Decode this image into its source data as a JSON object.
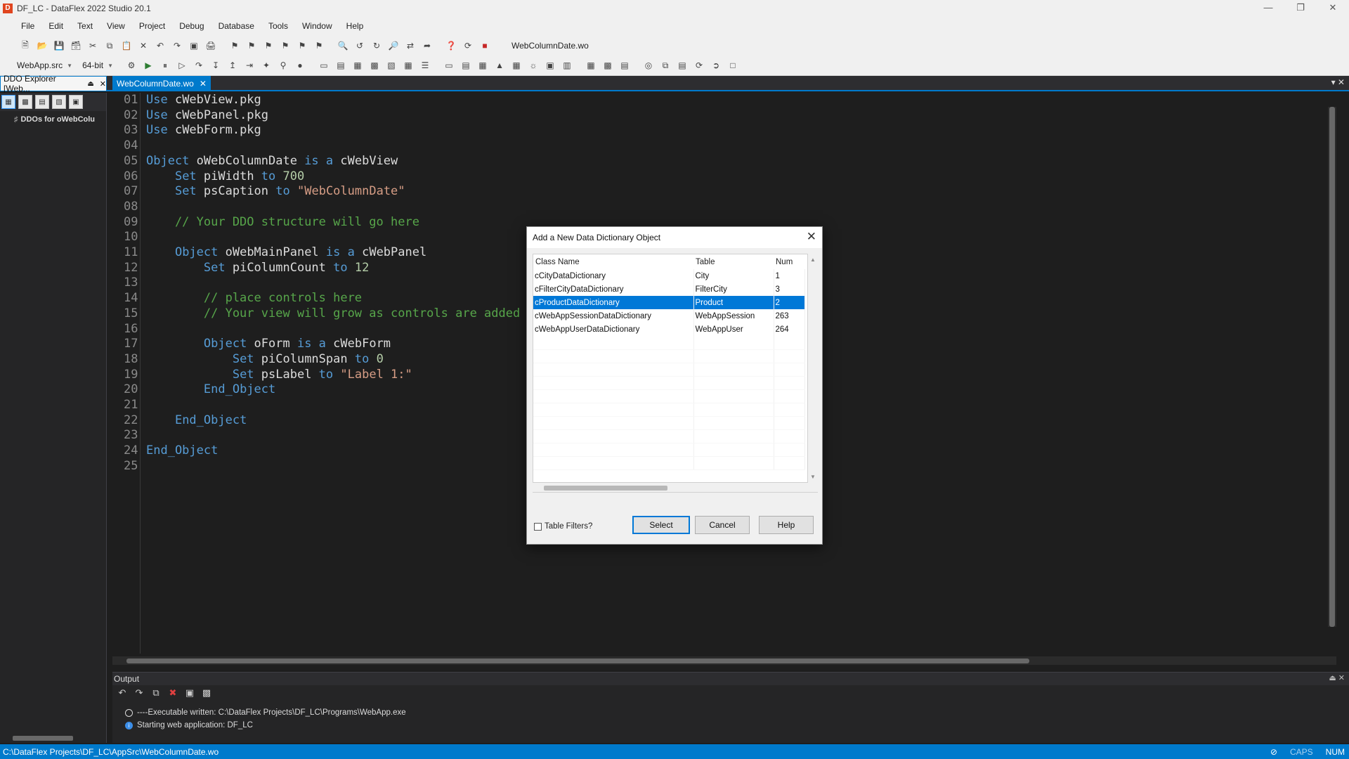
{
  "window": {
    "title": "DF_LC - DataFlex 2022 Studio 20.1",
    "app_icon": "dataflex-logo-icon",
    "controls": [
      "minimize",
      "restore",
      "close"
    ]
  },
  "menu": [
    "File",
    "Edit",
    "Text",
    "View",
    "Project",
    "Debug",
    "Database",
    "Tools",
    "Window",
    "Help"
  ],
  "toolbar": {
    "file_combo": "WebColumnDate.wo",
    "project_combo": "WebApp.src",
    "platform_combo": "64-bit"
  },
  "tabs": {
    "ddo_explorer": "DDO Explorer [Web...",
    "document": "WebColumnDate.wo"
  },
  "ddo_explorer": {
    "tree_root": "DDOs for oWebColu"
  },
  "editor": {
    "line_numbers": [
      "01",
      "02",
      "03",
      "04",
      "05",
      "06",
      "07",
      "08",
      "09",
      "10",
      "11",
      "12",
      "13",
      "14",
      "15",
      "16",
      "17",
      "18",
      "19",
      "20",
      "21",
      "22",
      "23",
      "24",
      "25"
    ],
    "lines": [
      [
        {
          "t": "Use",
          "c": "kw"
        },
        {
          "t": " cWebView.pkg",
          "c": ""
        }
      ],
      [
        {
          "t": "Use",
          "c": "kw"
        },
        {
          "t": " cWebPanel.pkg",
          "c": ""
        }
      ],
      [
        {
          "t": "Use",
          "c": "kw"
        },
        {
          "t": " cWebForm.pkg",
          "c": ""
        }
      ],
      [],
      [
        {
          "t": "Object",
          "c": "kw"
        },
        {
          "t": " oWebColumnDate ",
          "c": ""
        },
        {
          "t": "is a",
          "c": "kw"
        },
        {
          "t": " cWebView",
          "c": ""
        }
      ],
      [
        {
          "t": "    ",
          "c": ""
        },
        {
          "t": "Set",
          "c": "kw"
        },
        {
          "t": " piWidth ",
          "c": ""
        },
        {
          "t": "to",
          "c": "kw"
        },
        {
          "t": " ",
          "c": ""
        },
        {
          "t": "700",
          "c": "num"
        }
      ],
      [
        {
          "t": "    ",
          "c": ""
        },
        {
          "t": "Set",
          "c": "kw"
        },
        {
          "t": " psCaption ",
          "c": ""
        },
        {
          "t": "to",
          "c": "kw"
        },
        {
          "t": " ",
          "c": ""
        },
        {
          "t": "\"WebColumnDate\"",
          "c": "str"
        }
      ],
      [],
      [
        {
          "t": "    // Your DDO structure will go here",
          "c": "cmt"
        }
      ],
      [],
      [
        {
          "t": "    ",
          "c": ""
        },
        {
          "t": "Object",
          "c": "kw"
        },
        {
          "t": " oWebMainPanel ",
          "c": ""
        },
        {
          "t": "is a",
          "c": "kw"
        },
        {
          "t": " cWebPanel",
          "c": ""
        }
      ],
      [
        {
          "t": "        ",
          "c": ""
        },
        {
          "t": "Set",
          "c": "kw"
        },
        {
          "t": " piColumnCount ",
          "c": ""
        },
        {
          "t": "to",
          "c": "kw"
        },
        {
          "t": " ",
          "c": ""
        },
        {
          "t": "12",
          "c": "num"
        }
      ],
      [],
      [
        {
          "t": "        // place controls here",
          "c": "cmt"
        }
      ],
      [
        {
          "t": "        // Your view will grow as controls are added",
          "c": "cmt"
        }
      ],
      [],
      [
        {
          "t": "        ",
          "c": ""
        },
        {
          "t": "Object",
          "c": "kw"
        },
        {
          "t": " oForm ",
          "c": ""
        },
        {
          "t": "is a",
          "c": "kw"
        },
        {
          "t": " cWebForm",
          "c": ""
        }
      ],
      [
        {
          "t": "            ",
          "c": ""
        },
        {
          "t": "Set",
          "c": "kw"
        },
        {
          "t": " piColumnSpan ",
          "c": ""
        },
        {
          "t": "to",
          "c": "kw"
        },
        {
          "t": " ",
          "c": ""
        },
        {
          "t": "0",
          "c": "num"
        }
      ],
      [
        {
          "t": "            ",
          "c": ""
        },
        {
          "t": "Set",
          "c": "kw"
        },
        {
          "t": " psLabel ",
          "c": ""
        },
        {
          "t": "to",
          "c": "kw"
        },
        {
          "t": " ",
          "c": ""
        },
        {
          "t": "\"Label 1:\"",
          "c": "str"
        }
      ],
      [
        {
          "t": "        ",
          "c": ""
        },
        {
          "t": "End_Object",
          "c": "kw"
        }
      ],
      [],
      [
        {
          "t": "    ",
          "c": ""
        },
        {
          "t": "End_Object",
          "c": "kw"
        }
      ],
      [],
      [
        {
          "t": "End_Object",
          "c": "kw"
        }
      ],
      []
    ],
    "colors": {
      "keyword": "#569cd6",
      "string": "#d69d85",
      "number": "#b5cea8",
      "comment": "#57a64a"
    }
  },
  "dialog": {
    "title": "Add a New Data Dictionary Object",
    "columns": [
      "Class Name",
      "Table",
      "Num"
    ],
    "rows": [
      {
        "class_name": "cCityDataDictionary",
        "table": "City",
        "num": "1",
        "selected": false
      },
      {
        "class_name": "cFilterCityDataDictionary",
        "table": "FilterCity",
        "num": "3",
        "selected": false
      },
      {
        "class_name": "cProductDataDictionary",
        "table": "Product",
        "num": "2",
        "selected": true
      },
      {
        "class_name": "cWebAppSessionDataDictionary",
        "table": "WebAppSession",
        "num": "263",
        "selected": false
      },
      {
        "class_name": "cWebAppUserDataDictionary",
        "table": "WebAppUser",
        "num": "264",
        "selected": false
      }
    ],
    "table_filters_label": "Table Filters?",
    "table_filters_checked": false,
    "select_label": "Select",
    "cancel_label": "Cancel",
    "help_label": "Help"
  },
  "output": {
    "title": "Output",
    "lines": [
      {
        "icon": "circle-icon",
        "text": "----Executable written: C:\\DataFlex Projects\\DF_LC\\Programs\\WebApp.exe"
      },
      {
        "icon": "info-icon",
        "text": "Starting web application: DF_LC"
      }
    ]
  },
  "status": {
    "path": "C:\\DataFlex Projects\\DF_LC\\AppSrc\\WebColumnDate.wo",
    "caps": "CAPS",
    "num": "NUM"
  },
  "accent_colors": {
    "status_bar": "#007acc",
    "selection": "#0078d7",
    "editor_bg": "#1e1e1e"
  }
}
